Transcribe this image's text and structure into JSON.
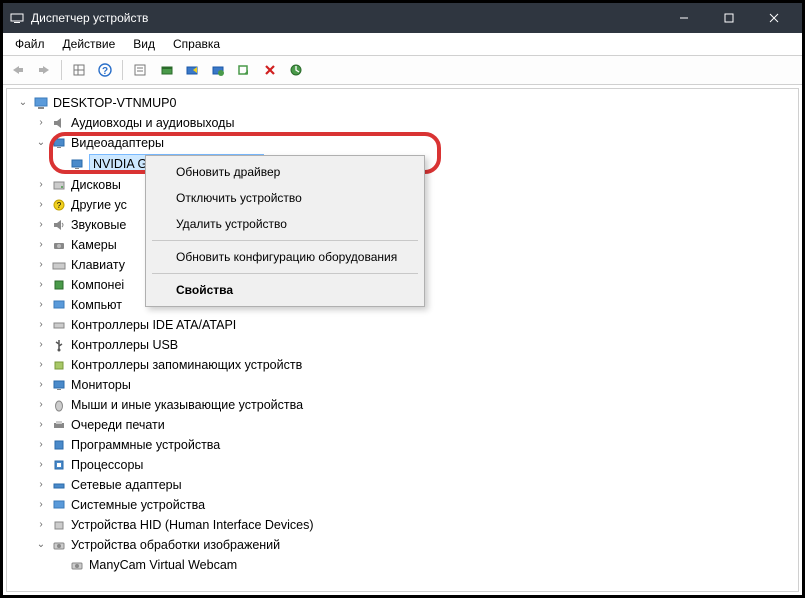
{
  "window": {
    "title": "Диспетчер устройств"
  },
  "menu": {
    "file": "Файл",
    "action": "Действие",
    "view": "Вид",
    "help": "Справка"
  },
  "tree": {
    "root": {
      "label": "DESKTOP-VTNMUP0",
      "expanded": true
    },
    "items": [
      {
        "label": "Аудиовходы и аудиовыходы",
        "expanded": false
      },
      {
        "label": "Видеоадаптеры",
        "expanded": true,
        "children": [
          {
            "label": "NVIDIA GeForce GTX 1050 Ti",
            "selected": true
          }
        ]
      },
      {
        "label": "Дисковы"
      },
      {
        "label": "Другие ус"
      },
      {
        "label": "Звуковые"
      },
      {
        "label": "Камеры"
      },
      {
        "label": "Клавиату"
      },
      {
        "label": "Компонеі"
      },
      {
        "label": "Компьют"
      },
      {
        "label": "Контроллеры IDE ATA/ATAPI"
      },
      {
        "label": "Контроллеры USB"
      },
      {
        "label": "Контроллеры запоминающих устройств"
      },
      {
        "label": "Мониторы"
      },
      {
        "label": "Мыши и иные указывающие устройства"
      },
      {
        "label": "Очереди печати"
      },
      {
        "label": "Программные устройства"
      },
      {
        "label": "Процессоры"
      },
      {
        "label": "Сетевые адаптеры"
      },
      {
        "label": "Системные устройства"
      },
      {
        "label": "Устройства HID (Human Interface Devices)"
      },
      {
        "label": "Устройства обработки изображений",
        "expanded": true,
        "children": [
          {
            "label": "ManyCam Virtual Webcam"
          }
        ]
      }
    ]
  },
  "context": {
    "update": "Обновить драйвер",
    "disable": "Отключить устройство",
    "remove": "Удалить устройство",
    "scan": "Обновить конфигурацию оборудования",
    "props": "Свойства"
  }
}
